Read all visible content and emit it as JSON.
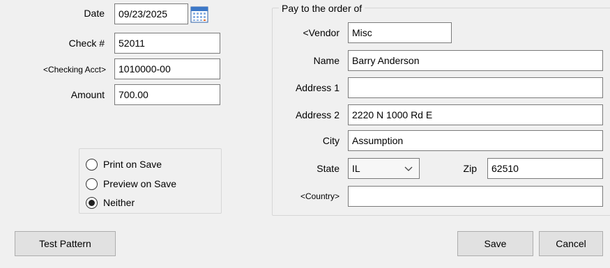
{
  "check": {
    "date_label": "Date",
    "date_value": "09/23/2025",
    "check_no_label": "Check #",
    "check_no_value": "52011",
    "account_label": "<Checking Acct>",
    "account_value": "1010000-00",
    "amount_label": "Amount",
    "amount_value": "700.00"
  },
  "print_options": {
    "items": [
      {
        "label": "Print on Save",
        "selected": false
      },
      {
        "label": "Preview on Save",
        "selected": false
      },
      {
        "label": "Neither",
        "selected": true
      }
    ]
  },
  "payee": {
    "group_title": "Pay to the order of",
    "vendor_label": "<Vendor",
    "vendor_value": "Misc",
    "name_label": "Name",
    "name_value": "Barry Anderson",
    "address1_label": "Address 1",
    "address1_value": "",
    "address2_label": "Address 2",
    "address2_value": "2220 N 1000 Rd E",
    "city_label": "City",
    "city_value": "Assumption",
    "state_label": "State",
    "state_value": "IL",
    "zip_label": "Zip",
    "zip_value": "62510",
    "country_label": "<Country>",
    "country_value": ""
  },
  "buttons": {
    "test_pattern": "Test Pattern",
    "save": "Save",
    "cancel": "Cancel"
  },
  "icons": {
    "calendar": "calendar-icon",
    "dropdown": "chevron-down-icon"
  }
}
